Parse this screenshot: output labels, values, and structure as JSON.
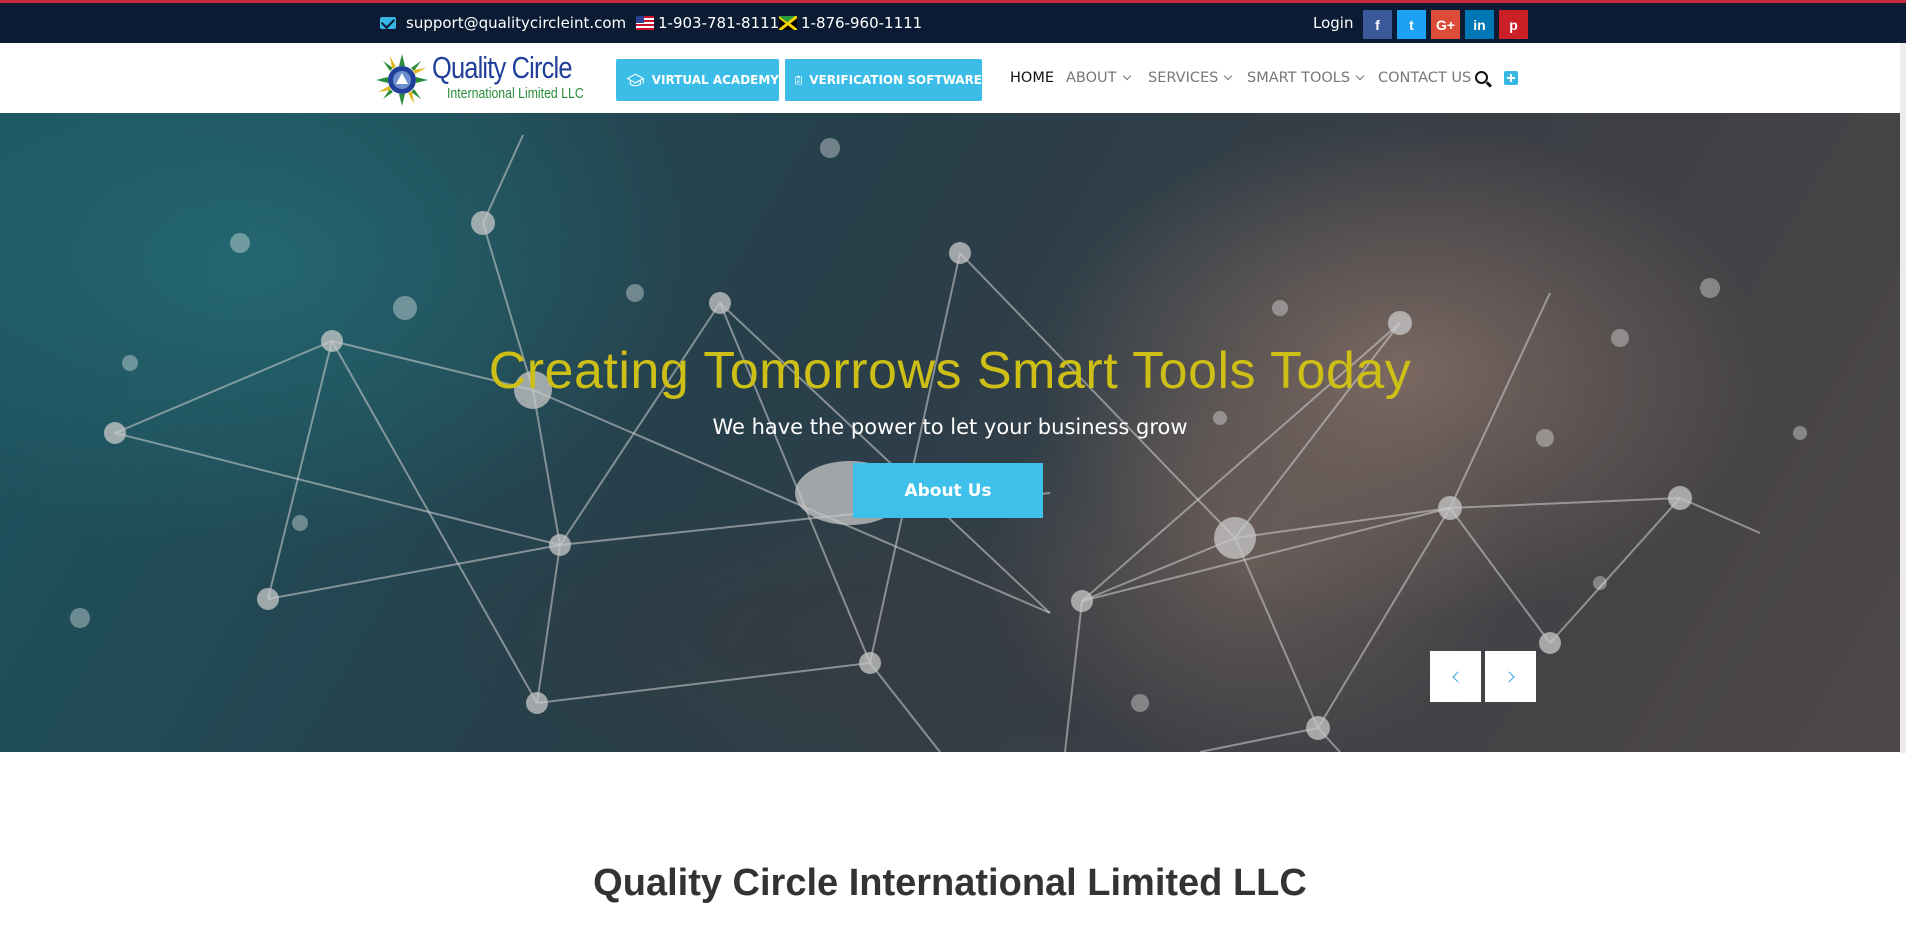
{
  "topbar": {
    "email": "support@qualitycircleint.com",
    "phone_us": "1-903-781-8111",
    "phone_jm": "1-876-960-1111",
    "login": "Login",
    "social": [
      {
        "name": "facebook-icon",
        "glyph": "f",
        "color": "#3b5998"
      },
      {
        "name": "twitter-icon",
        "glyph": "t",
        "color": "#1da1f2"
      },
      {
        "name": "google-plus-icon",
        "glyph": "G+",
        "color": "#dd4b39"
      },
      {
        "name": "linkedin-icon",
        "glyph": "in",
        "color": "#0077b5"
      },
      {
        "name": "pinterest-icon",
        "glyph": "p",
        "color": "#cb2027"
      }
    ]
  },
  "logo": {
    "line1": "Quality Circle",
    "line2": "International Limited LLC"
  },
  "header_buttons": {
    "virtual_academy": "VIRTUAL ACADEMY",
    "verification_software": "VERIFICATION SOFTWARE"
  },
  "nav": {
    "home": "HOME",
    "about": "ABOUT",
    "services": "SERVICES",
    "smart_tools": "SMART TOOLS",
    "contact": "CONTACT US"
  },
  "hero": {
    "title": "Creating Tomorrows Smart Tools Today",
    "subtitle": "We have the power to let your business grow",
    "button": "About Us"
  },
  "section": {
    "title": "Quality Circle International Limited LLC"
  },
  "colors": {
    "accent": "#3bbde8",
    "topbar": "#0b1b34",
    "hero_title": "#cdbf16",
    "top_accent": "#c62a3a"
  }
}
